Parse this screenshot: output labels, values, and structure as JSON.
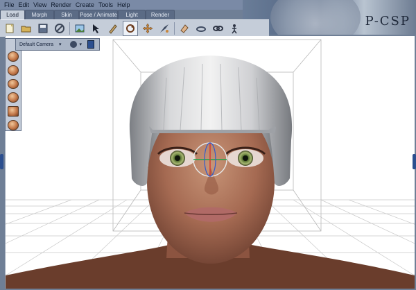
{
  "menu": [
    "File",
    "Edit",
    "View",
    "Render",
    "Create",
    "Tools",
    "Help"
  ],
  "brand": {
    "text": "P-CSP"
  },
  "tabs": [
    {
      "label": "Load",
      "active": true
    },
    {
      "label": "Morph",
      "active": false
    },
    {
      "label": "Skin",
      "active": false
    },
    {
      "label": "Pose / Animate",
      "active": false
    },
    {
      "label": "Light",
      "active": false
    },
    {
      "label": "Render",
      "active": false
    }
  ],
  "toolbar": {
    "icons": [
      "new-file-icon",
      "open-folder-icon",
      "save-icon",
      "cancel-icon",
      "import-image-icon",
      "select-arrow-icon",
      "pen-icon",
      "rotate-icon",
      "move-icon",
      "scale-icon",
      "eraser-icon",
      "orbit-icon",
      "chain-icon",
      "pose-icon"
    ]
  },
  "viewport": {
    "camera_selector": "Default Camera"
  },
  "colors": {
    "accent": "#2c4f8f",
    "panel": "#c5cdd9"
  }
}
